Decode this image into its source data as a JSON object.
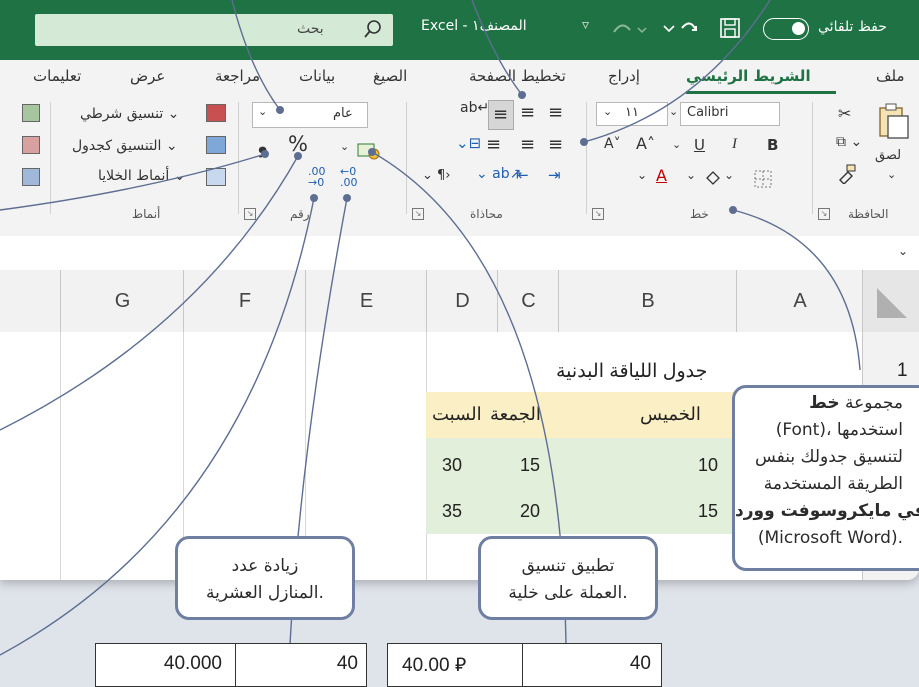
{
  "titlebar": {
    "autosave_label": "حفظ تلقائي",
    "doc_title": "Excel - المصنف١",
    "search_placeholder": "بحث"
  },
  "tabs": [
    "ملف",
    "الشريط الرئيسي",
    "إدراج",
    "تخطيط الصفحة",
    "الصيغ",
    "بيانات",
    "مراجعة",
    "عرض",
    "تعليمات"
  ],
  "ribbon": {
    "clipboard": {
      "label": "الحافظة",
      "paste": "لصق"
    },
    "font": {
      "label": "خط",
      "font_name": "Calibri",
      "font_size": "١١",
      "bold": "B",
      "italic": "I",
      "underline": "U"
    },
    "alignment": {
      "label": "محاذاة"
    },
    "number": {
      "label": "رقم",
      "format": "عام"
    },
    "styles": {
      "label": "أنماط",
      "conditional": "تنسيق شرطي",
      "as_table": "التنسيق كجدول",
      "cell_styles": "أنماط الخلايا"
    }
  },
  "columns": [
    "A",
    "B",
    "C",
    "D",
    "E",
    "F",
    "G"
  ],
  "row_numbers": [
    "1"
  ],
  "sheet": {
    "title": "جدول اللياقة البدنية",
    "headers": [
      "الخميس",
      "الجمعة",
      "السبت"
    ],
    "rows": [
      [
        "10",
        "15",
        "30"
      ],
      [
        "15",
        "20",
        "35"
      ]
    ]
  },
  "callouts": {
    "font_group": {
      "l1a": "مجموعة ",
      "l1b": "خط",
      "l2": "(Font)، استخدمها",
      "l3": "لتنسيق جدولك بنفس",
      "l4": "الطريقة المستخدمة",
      "l5": "في مايكروسوفت وورد",
      "l6": "(Microsoft Word)."
    },
    "currency": {
      "l1": "تطبيق تنسيق",
      "l2": "العملة على خلية."
    },
    "decimal": {
      "l1": "زيادة عدد",
      "l2": "المنازل العشرية."
    }
  },
  "examples": {
    "currency": {
      "after": "40.00 ⃁",
      "before": "40"
    },
    "decimal": {
      "after": "40.000",
      "before": "40"
    }
  },
  "colors": {
    "excel_green": "#1f7244",
    "callout_border": "#6f7fa1",
    "header_fill": "#fbefc6",
    "data_fill": "#e2efda"
  }
}
